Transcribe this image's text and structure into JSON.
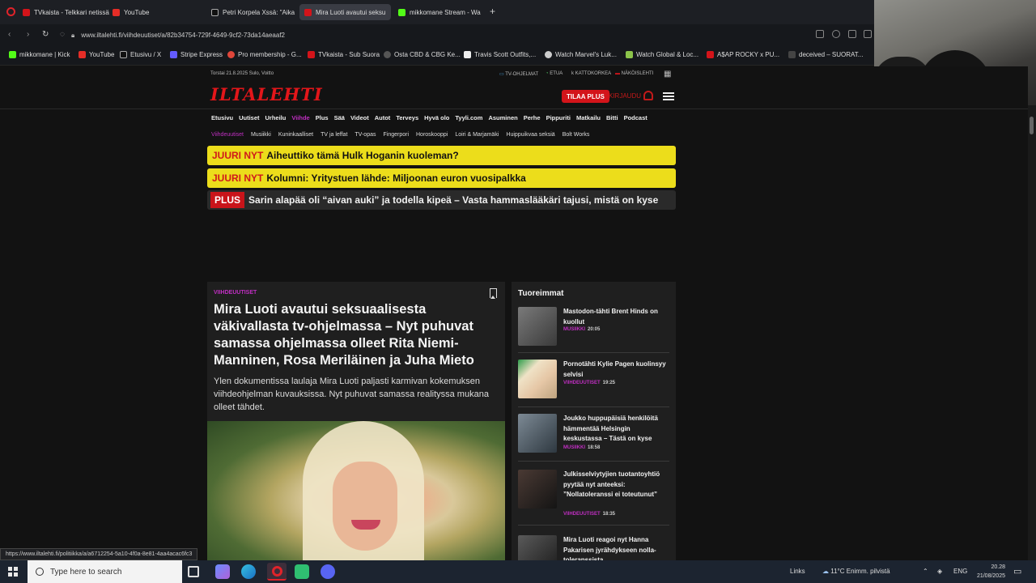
{
  "browser": {
    "tabs": [
      {
        "label": "TVkaista - Telkkari netissä",
        "color": "#d3141a"
      },
      {
        "label": "YouTube",
        "color": "#e52d27"
      },
      {
        "label": "Petri Korpela Xssä: \"Aika",
        "color": "#111111"
      },
      {
        "label": "Mira Luoti avautui seksu",
        "color": "#d3141a"
      },
      {
        "label": "mikkomane Stream - Wa",
        "color": "#53fc18"
      }
    ],
    "new_tab": "+",
    "url": "www.iltalehti.fi/viihdeuutiset/a/82b34754-729f-4649-9cf2-73da14aeaaf2",
    "bookmarks": [
      {
        "label": "mikkomane | Kick",
        "color": "#53fc18"
      },
      {
        "label": "YouTube",
        "color": "#e52d27"
      },
      {
        "label": "Etusivu / X",
        "color": "#111111"
      },
      {
        "label": "Stripe Express",
        "color": "#635bff"
      },
      {
        "label": "Pro membership - G...",
        "color": "#e0463a"
      },
      {
        "label": "TVkaista - Sub Suora",
        "color": "#d3141a"
      },
      {
        "label": "Osta CBD & CBG Ke...",
        "color": "#555555"
      },
      {
        "label": "Travis Scott Outfits,...",
        "color": "#eeeeee"
      },
      {
        "label": "Watch Marvel's Luk...",
        "color": "#cccccc"
      },
      {
        "label": "Watch Global & Loc...",
        "color": "#8bc34a"
      },
      {
        "label": "A$AP ROCKY x PU...",
        "color": "#d3141a"
      },
      {
        "label": "deceived – SUORAT...",
        "color": "#444444"
      }
    ]
  },
  "site": {
    "date_weather": "Torstai 21.8.2025 Sulo, Voitto",
    "top_links": [
      "TV-OHJELMAT",
      "ETUA",
      "KATTOKORKEA",
      "NÄKÖISLEHTI"
    ],
    "logo": "ILTALEHTI",
    "subscribe": "TILAA PLUS",
    "login": "KIRJAUDU",
    "main_nav": [
      "Etusivu",
      "Uutiset",
      "Urheilu",
      "Viihde",
      "Plus",
      "Sää",
      "Videot",
      "Autot",
      "Terveys",
      "Hyvä olo",
      "Tyyli.com",
      "Asuminen",
      "Perhe",
      "Pippuriti",
      "Matkailu",
      "Bitti",
      "Podcast"
    ],
    "main_nav_active": "Viihde",
    "sub_nav": [
      "Viihdeuutiset",
      "Musiikki",
      "Kuninkaalliset",
      "TV ja leffat",
      "TV-opas",
      "Fingerpori",
      "Horoskooppi",
      "Loiri & Marjamäki",
      "Huippuikvaa seksiä",
      "Bolt Works"
    ],
    "sub_nav_active": "Viihdeuutiset",
    "flash": [
      {
        "tag": "JUURI NYT",
        "text": "Aiheuttiko tämä Hulk Hoganin kuoleman?"
      },
      {
        "tag": "JUURI NYT",
        "text": "Kolumni: Yritystuen lähde: Miljoonan euron vuosipalkka"
      }
    ],
    "plus_flash": {
      "tag": "PLUS",
      "text": "Sarin alapää oli “aivan auki” ja todella kipeä – Vasta hammaslääkäri tajusi, mistä on kyse"
    }
  },
  "article": {
    "category": "VIIHDEUUTISET",
    "title": "Mira Luoti avautui seksuaalisesta väkivallasta tv-ohjelmassa – Nyt puhuvat samassa ohjelmassa olleet Rita Niemi-Manninen, Rosa Meriläinen ja Juha Mieto",
    "lead": "Ylen dokumentissa laulaja Mira Luoti paljasti karmivan kokemuksen viihdeohjelman kuvauksissa. Nyt puhuvat samassa realityssa mukana olleet tähdet."
  },
  "latest": {
    "title": "Tuoreimmat",
    "items": [
      {
        "headline": "Mastodon-tähti Brent Hinds on kuollut",
        "category": "MUSIIKKI",
        "time": "20:05",
        "thumb": "#5a5a5a"
      },
      {
        "headline": "Pornotähti Kylie Pagen kuolinsyy selvisi",
        "category": "VIIHDEUUTISET",
        "time": "19:25",
        "thumb": "#d8c3a4"
      },
      {
        "headline": "Joukko huppupäisiä henkilöitä hämmentää Helsingin keskustassa – Tästä on kyse",
        "category": "MUSIIKKI",
        "time": "18:58",
        "thumb": "#3e4a55"
      },
      {
        "headline": "Julkisselviytyjien tuotantoyhtiö pyytää nyt anteeksi: ”Nollatoleranssi ei toteutunut”",
        "category": "VIIHDEUUTISET",
        "time": "18:35",
        "thumb": "#2b2b2b"
      },
      {
        "headline": "Mira Luoti reagoi nyt Hanna Pakarisen jyrähdykseen nolla-toleranssista",
        "category": "",
        "time": "",
        "thumb": "#333333"
      }
    ]
  },
  "status_url": "https://www.iltalehti.fi/politiikka/a/a6712254-5a10-4f0a-8e81-4aa4acac6fc3",
  "taskbar": {
    "search_placeholder": "Type here to search",
    "links": "Links",
    "weather": "11°C  Enimm. pilvistä",
    "lang": "ENG",
    "time": "20.28",
    "date": "21/08/2025"
  }
}
